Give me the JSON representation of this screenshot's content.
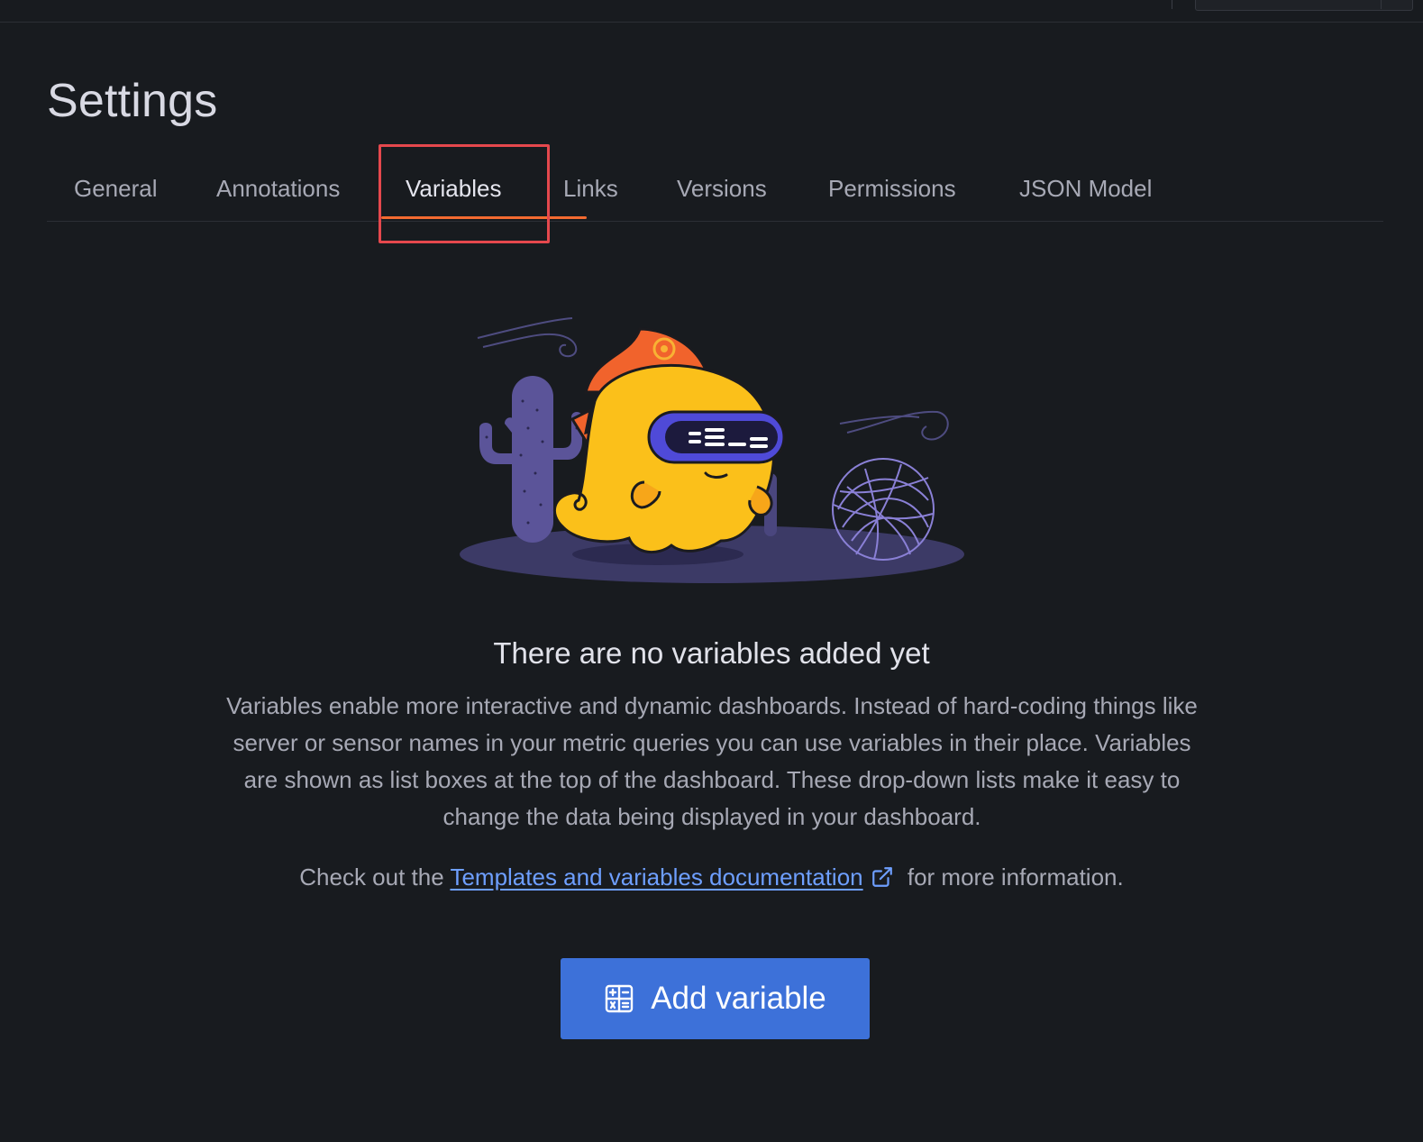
{
  "page": {
    "title": "Settings"
  },
  "tabs": [
    {
      "label": "General",
      "active": false
    },
    {
      "label": "Annotations",
      "active": false
    },
    {
      "label": "Variables",
      "active": true
    },
    {
      "label": "Links",
      "active": false
    },
    {
      "label": "Versions",
      "active": false
    },
    {
      "label": "Permissions",
      "active": false
    },
    {
      "label": "JSON Model",
      "active": false
    }
  ],
  "empty_state": {
    "illustration_icon": "grafana-mascot-desert-illustration",
    "title": "There are no variables added yet",
    "body": "Variables enable more interactive and dynamic dashboards. Instead of hard-coding things like server or sensor names in your metric queries you can use variables in their place. Variables are shown as list boxes at the top of the dashboard. These drop-down lists make it easy to change the data being displayed in your dashboard.",
    "doc_prefix": "Check out the ",
    "doc_link_label": "Templates and variables documentation",
    "doc_link_icon": "external-link-icon",
    "doc_suffix": " for more information."
  },
  "actions": {
    "add_variable_label": "Add variable",
    "add_variable_icon": "calculator-alt-icon"
  },
  "colors": {
    "background": "#181b1f",
    "active_tab_underline": "#f36a30",
    "highlight_box": "#e5484d",
    "link": "#6e9fff",
    "primary_button": "#3d71d9"
  }
}
